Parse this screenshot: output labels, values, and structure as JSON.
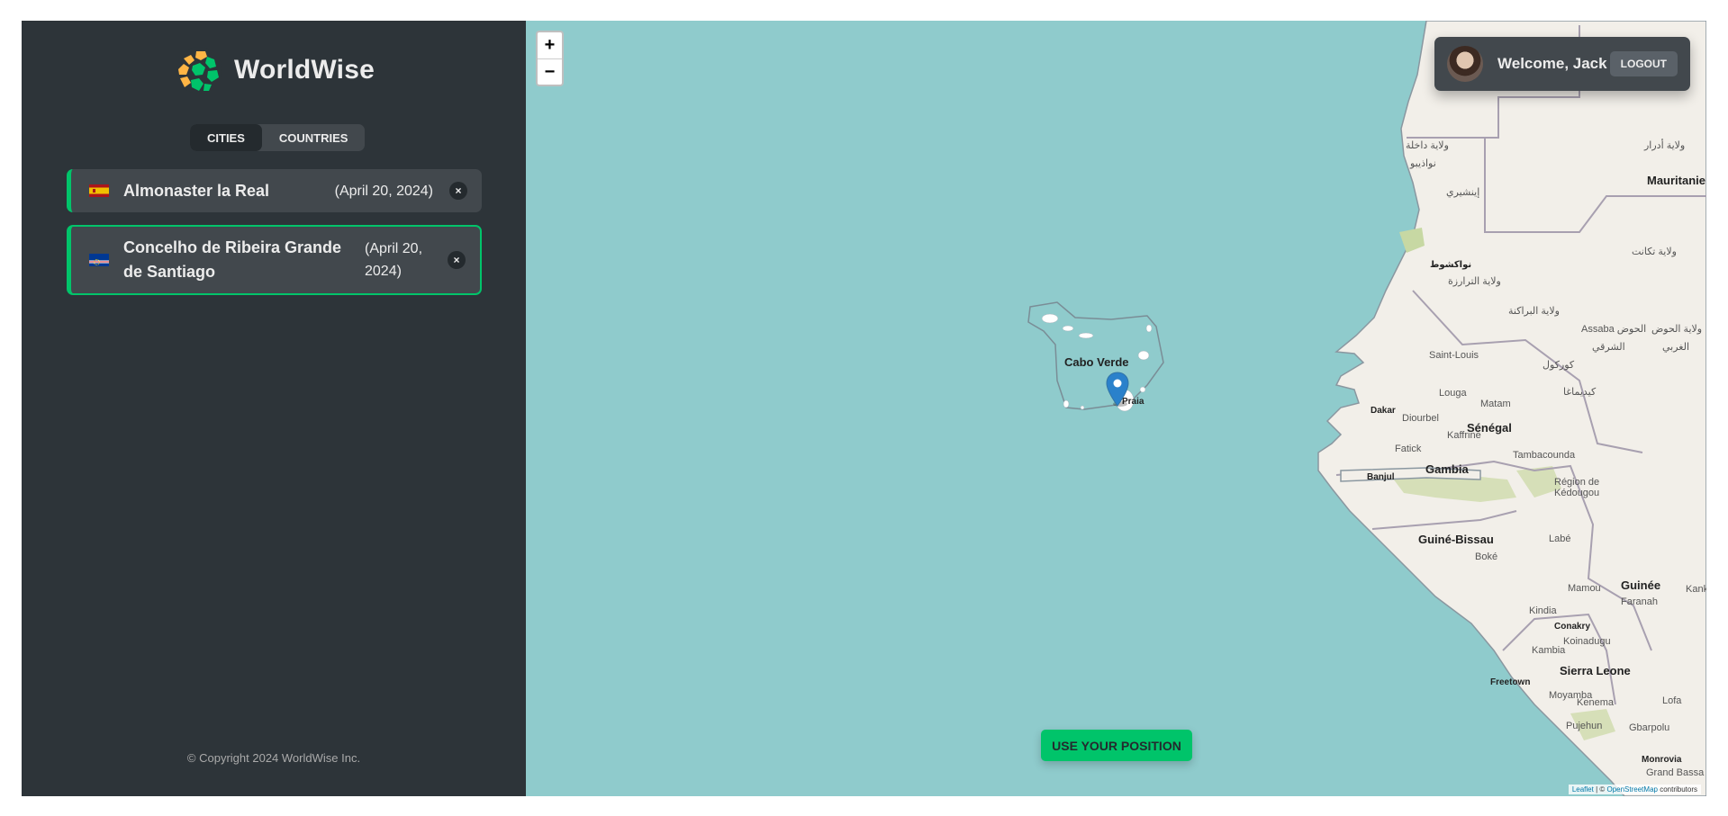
{
  "app": {
    "title": "WorldWise",
    "copyright": "© Copyright 2024 WorldWise Inc."
  },
  "tabs": [
    {
      "label": "CITIES",
      "active": true
    },
    {
      "label": "COUNTRIES",
      "active": false
    }
  ],
  "cities": [
    {
      "flag": "spain-flag",
      "name": "Almonaster la Real",
      "date": "(April 20, 2024)",
      "delete": "×"
    },
    {
      "flag": "cape-verde-flag",
      "name": "Concelho de Ribeira Grande de Santiago",
      "date": "(April 20, 2024)",
      "delete": "×"
    }
  ],
  "map": {
    "zoom_in": "+",
    "zoom_out": "−",
    "use_position_label": "USE YOUR POSITION",
    "attribution": {
      "leaflet": "Leaflet",
      "separator": " | © ",
      "osm": "OpenStreetMap",
      "suffix": " contributors"
    },
    "labels": {
      "cabo_verde": "Cabo Verde",
      "praia": "Praia",
      "mauritanie": "Mauritanie",
      "senegal": "Sénégal",
      "gambia": "Gambia",
      "guinee_bissau": "Guiné-Bissau",
      "guinee": "Guinée",
      "sierra_leone": "Sierra Leone",
      "dakar": "Dakar",
      "banjul": "Banjul",
      "conakry": "Conakry",
      "freetown": "Freetown",
      "monrovia": "Monrovia",
      "nouakchott": "نواكشوط",
      "saint_louis": "Saint-Louis",
      "louga": "Louga",
      "matam": "Matam",
      "diourbel": "Diourbel",
      "kaffrine": "Kaffrine",
      "fatick": "Fatick",
      "tambacounda": "Tambacounda",
      "kedougou": "Région de Kédougou",
      "labe": "Labé",
      "boke": "Boké",
      "mamou": "Mamou",
      "faranah": "Faranah",
      "kindia": "Kindia",
      "kambia": "Kambia",
      "koinadugu": "Koinadugu",
      "moyamba": "Moyamba",
      "kenema": "Kenema",
      "pujehun": "Pujehun",
      "gbarpolu": "Gbarpolu",
      "grand_bassa": "Grand Bassa",
      "lofa": "Lofa",
      "kankan": "Kank",
      "assaba": "Assaba الحوض",
      "hodh": "ولاية الحوض",
      "gharbi": "الغربي",
      "charqi": "الشرقي",
      "adrar": "ولاية أدرار",
      "dakhlet": "ولاية داخلة",
      "nouadhibou": "نواذيبو",
      "inchiri": "إينشيري",
      "tagant": "ولاية تكانت",
      "trarza": "ولاية الترارزة",
      "brakna": "ولاية البراكنة",
      "gorgol": "كوركول",
      "guidimakha": "كيديماغا"
    }
  },
  "user": {
    "welcome": "Welcome, Jack",
    "logout": "LOGOUT"
  },
  "colors": {
    "brand": "#00c46a",
    "sidebar": "#2d3439",
    "item": "#42484d",
    "sea": "#8fcbcc",
    "land": "#f2efe9"
  }
}
